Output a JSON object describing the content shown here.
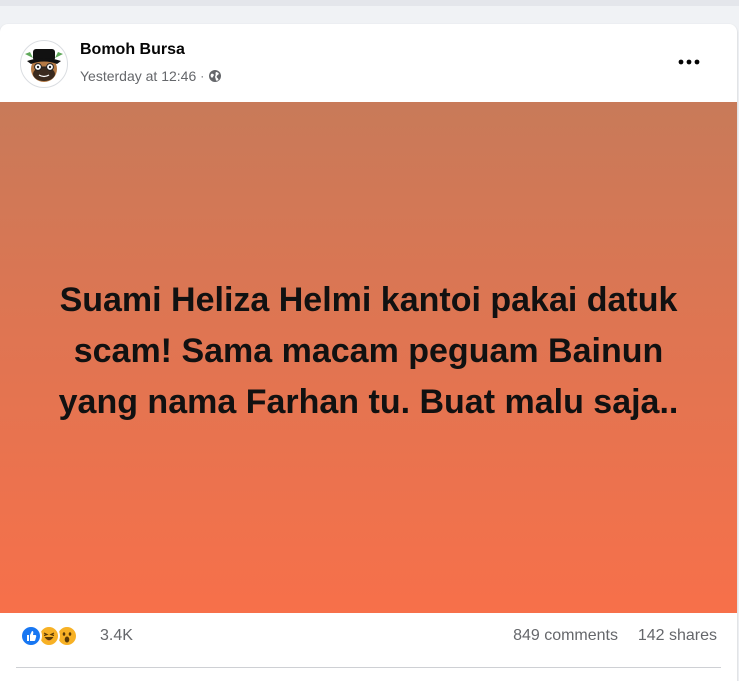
{
  "post": {
    "author": "Bomoh Bursa",
    "timestamp": "Yesterday at 12:46",
    "separator": "·",
    "privacy_icon": "globe-icon",
    "more_icon": "more-options-icon",
    "body_text": "Suami Heliza Helmi kantoi pakai datuk scam! Sama macam peguam Bainun yang nama Farhan tu. Buat malu saja..",
    "background_gradient": [
      "#c87a59",
      "#df7552",
      "#f7704a"
    ]
  },
  "engagement": {
    "reaction_icons": [
      "like-icon",
      "haha-icon",
      "wow-icon"
    ],
    "reaction_count": "3.4K",
    "comments": "849 comments",
    "shares": "142 shares"
  },
  "colors": {
    "like_blue": "#1877f2",
    "emoji_yellow": "#f7b125",
    "secondary_text": "#65676b"
  }
}
